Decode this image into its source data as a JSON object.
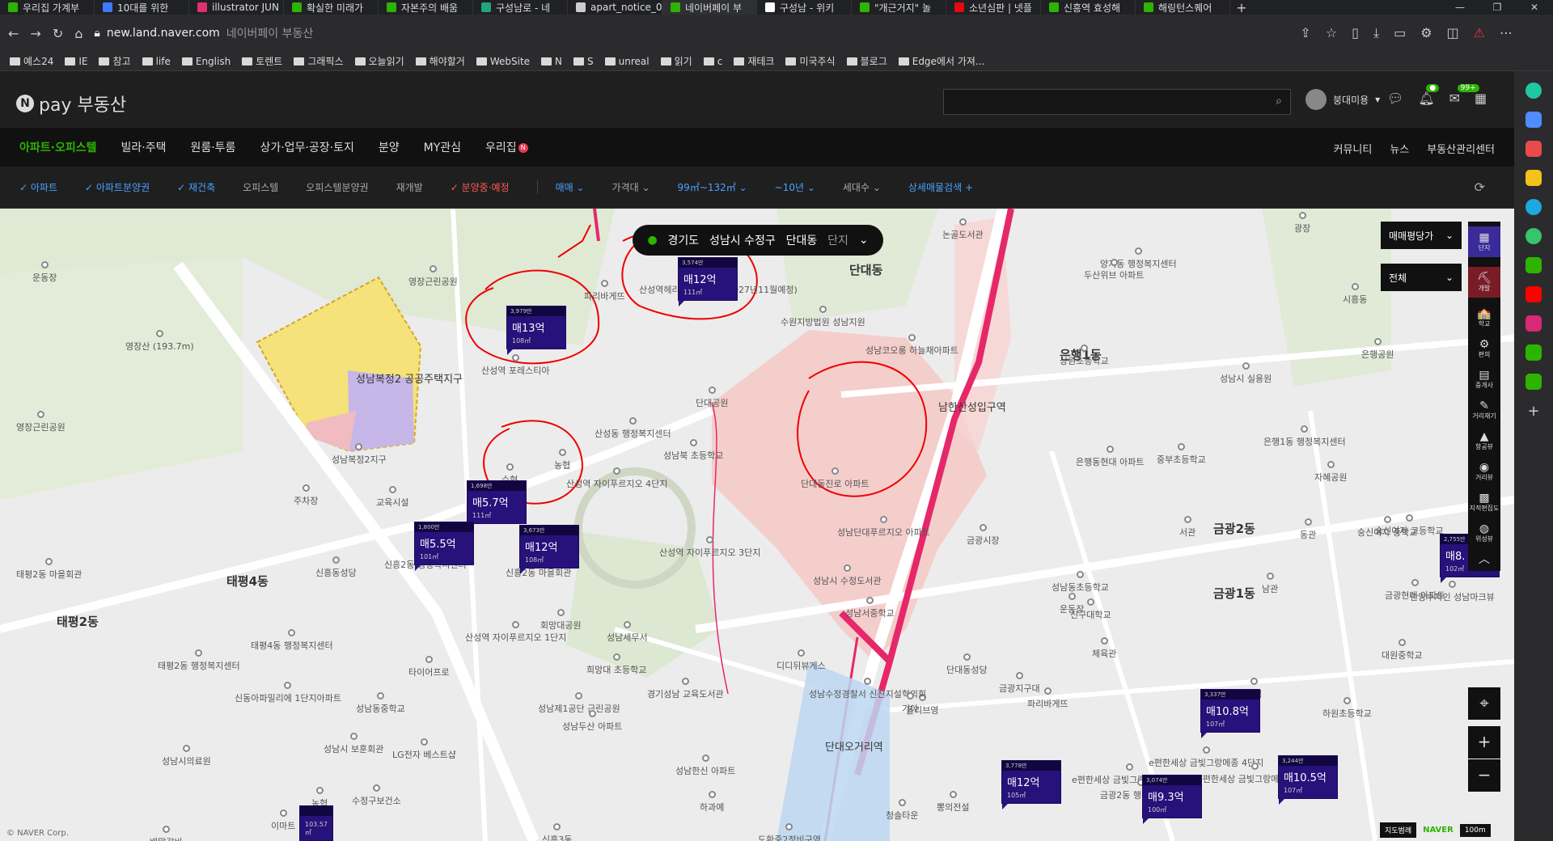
{
  "browser": {
    "tabs": [
      {
        "label": "우리집 가계부",
        "color": "#2db400"
      },
      {
        "label": "10대를 위한",
        "color": "#3b7bff"
      },
      {
        "label": "illustrator JUN",
        "color": "#e1306c"
      },
      {
        "label": "확실한 미래가",
        "color": "#2db400"
      },
      {
        "label": "자본주의 배움",
        "color": "#2db400"
      },
      {
        "label": "구성남로 - 네",
        "color": "#1fa67a"
      },
      {
        "label": "apart_notice_0",
        "color": "#cccccc"
      },
      {
        "label": "네이버페이 부",
        "color": "#2db400"
      },
      {
        "label": "구성남 - 위키",
        "color": "#ffffff"
      },
      {
        "label": "\"개근거지\" 놀",
        "color": "#2db400"
      },
      {
        "label": "소년심판 | 넷플",
        "color": "#e50914"
      },
      {
        "label": "신흥역 효성해",
        "color": "#2db400"
      },
      {
        "label": "해링턴스퀘어",
        "color": "#2db400"
      }
    ],
    "url": "new.land.naver.com",
    "page_title": "네이버페이 부동산",
    "bookmarks": [
      "예스24",
      "IE",
      "참고",
      "life",
      "English",
      "토렌트",
      "그래픽스",
      "오늘읽기",
      "해야할거",
      "WebSite",
      "N",
      "S",
      "unreal",
      "읽기",
      "c",
      "재테크",
      "미국주식",
      "블로그",
      "Edge에서 가져..."
    ]
  },
  "header": {
    "logo": "pay 부동산",
    "user": "붕대미용",
    "notif_badge": "99+"
  },
  "menu": {
    "items": [
      "아파트·오피스텔",
      "빌라·주택",
      "원룸·투룸",
      "상가·업무·공장·토지",
      "분양",
      "MY관심",
      "우리집"
    ],
    "right": [
      "커뮤니티",
      "뉴스",
      "부동산관리센터"
    ],
    "new_dot": "N"
  },
  "filters": {
    "items": [
      {
        "label": "✓ 아파트",
        "style": "on"
      },
      {
        "label": "✓ 아파트분양권",
        "style": "on"
      },
      {
        "label": "✓ 재건축",
        "style": "on"
      },
      {
        "label": "오피스텔",
        "style": ""
      },
      {
        "label": "오피스텔분양권",
        "style": ""
      },
      {
        "label": "재개발",
        "style": ""
      },
      {
        "label": "✓ 분양중·예정",
        "style": "red"
      },
      {
        "label": "매매 ⌄",
        "style": "dd sep"
      },
      {
        "label": "가격대 ⌄",
        "style": ""
      },
      {
        "label": "99㎡~132㎡ ⌄",
        "style": "dd"
      },
      {
        "label": "~10년 ⌄",
        "style": "dd"
      },
      {
        "label": "세대수 ⌄",
        "style": ""
      },
      {
        "label": "상세매물검색 +",
        "style": "dd"
      }
    ]
  },
  "location": {
    "province": "경기도",
    "city": "성남시 수정구",
    "dong": "단대동",
    "mode": "단지"
  },
  "map_controls": {
    "price_dropdown": "매매평당가",
    "all_dropdown": "전체",
    "tools": [
      {
        "icon": "▦",
        "label": "단지",
        "style": "blu"
      },
      {
        "icon": "⛏",
        "label": "개발",
        "style": "sel"
      },
      {
        "icon": "🏫",
        "label": "학교",
        "style": ""
      },
      {
        "icon": "⚙",
        "label": "편의",
        "style": ""
      },
      {
        "icon": "▤",
        "label": "중개사",
        "style": ""
      },
      {
        "icon": "✎",
        "label": "거리재기",
        "style": ""
      },
      {
        "icon": "▲",
        "label": "항공뷰",
        "style": ""
      },
      {
        "icon": "◉",
        "label": "거리뷰",
        "style": ""
      },
      {
        "icon": "▩",
        "label": "지적편집도",
        "style": ""
      },
      {
        "icon": "◍",
        "label": "위성뷰",
        "style": ""
      },
      {
        "icon": "︿",
        "label": "",
        "style": ""
      }
    ],
    "zoom_in": "+",
    "zoom_out": "−",
    "gps": "⌖",
    "map_legend": "지도범례",
    "naver": "NAVER",
    "scale": "100m"
  },
  "copyright": "© NAVER Corp.",
  "price_markers": [
    {
      "top": "3,979만",
      "price": "매13억",
      "area": "108㎡"
    },
    {
      "top": "3,574만",
      "price": "매12억",
      "area": "111㎡"
    },
    {
      "top": "1,698만",
      "price": "매5.7억",
      "area": "111㎡"
    },
    {
      "top": "1,800만",
      "price": "매5.5억",
      "area": "101㎡"
    },
    {
      "top": "3,673만",
      "price": "매12억",
      "area": "108㎡"
    },
    {
      "top": "2,755만",
      "price": "매8.",
      "area": "102㎡"
    },
    {
      "top": "3,337만",
      "price": "매10.8억",
      "area": "107㎡"
    },
    {
      "top": "3,778만",
      "price": "매12억",
      "area": "105㎡"
    },
    {
      "top": "3,074만",
      "price": "매9.3억",
      "area": "100㎡"
    },
    {
      "top": "3,244만",
      "price": "매10.5억",
      "area": "107㎡"
    },
    {
      "top": "",
      "price": "",
      "area": "103.57㎡"
    }
  ],
  "places": [
    {
      "text": "단대동",
      "cls": "big"
    },
    {
      "text": "성남복정2 공공주택지구",
      "cls": "mid"
    },
    {
      "text": "태평4동",
      "cls": "big"
    },
    {
      "text": "태평2동",
      "cls": "big"
    },
    {
      "text": "은행1동",
      "cls": "big"
    },
    {
      "text": "금광2동",
      "cls": "big"
    },
    {
      "text": "금광1동",
      "cls": "big"
    },
    {
      "text": "산성역헤리스톤아파트 (2027년11월예정)",
      "cls": ""
    },
    {
      "text": "영장근린공원",
      "cls": ""
    },
    {
      "text": "파리바게뜨",
      "cls": ""
    },
    {
      "text": "산성역 포레스티아",
      "cls": ""
    },
    {
      "text": "산성역 자이푸르지오 4단지",
      "cls": ""
    },
    {
      "text": "산성역 자이푸르지오 3단지",
      "cls": ""
    },
    {
      "text": "산성역 자이푸르지오 1단지",
      "cls": ""
    },
    {
      "text": "신흥2동 행정복지센터",
      "cls": ""
    },
    {
      "text": "남한산성입구역",
      "cls": "mid"
    },
    {
      "text": "단대오거리역",
      "cls": "mid"
    },
    {
      "text": "단대동진로 아파트",
      "cls": ""
    },
    {
      "text": "성남단대푸르지오 아파트",
      "cls": ""
    },
    {
      "text": "성남코오롱 하늘채아파트",
      "cls": ""
    },
    {
      "text": "수원지방법원 성남지원",
      "cls": ""
    },
    {
      "text": "단대공원",
      "cls": ""
    },
    {
      "text": "성남시 수정도서관",
      "cls": ""
    },
    {
      "text": "성남서중학교",
      "cls": ""
    },
    {
      "text": "디디뒤뷰게스",
      "cls": ""
    },
    {
      "text": "성남세무서",
      "cls": ""
    },
    {
      "text": "회망대공원",
      "cls": ""
    },
    {
      "text": "희망대 초등학교",
      "cls": ""
    },
    {
      "text": "경기성남 교육도서관",
      "cls": ""
    },
    {
      "text": "성남제1공단 근린공원",
      "cls": ""
    },
    {
      "text": "영장산 (193.7m)",
      "cls": ""
    },
    {
      "text": "운동장",
      "cls": ""
    },
    {
      "text": "신흥동성당",
      "cls": ""
    },
    {
      "text": "태평4동 행정복지센터",
      "cls": ""
    },
    {
      "text": "태평2동 행정복지센터",
      "cls": ""
    },
    {
      "text": "신동아파밀리에 1단지아파트",
      "cls": ""
    },
    {
      "text": "성남동중학교",
      "cls": ""
    },
    {
      "text": "성남시 보훈회관",
      "cls": ""
    },
    {
      "text": "LG전자 베스트샵",
      "cls": ""
    },
    {
      "text": "수정구보건소",
      "cls": ""
    },
    {
      "text": "성남시의료원",
      "cls": ""
    },
    {
      "text": "배말갈비",
      "cls": ""
    },
    {
      "text": "농협",
      "cls": ""
    },
    {
      "text": "신흥3동",
      "cls": ""
    },
    {
      "text": "하과예",
      "cls": ""
    },
    {
      "text": "청솔타운",
      "cls": ""
    },
    {
      "text": "뽕의전설",
      "cls": ""
    },
    {
      "text": "도환중2정비구역",
      "cls": ""
    },
    {
      "text": "e편한세상 금빛그랑메종 6단지",
      "cls": ""
    },
    {
      "text": "e편한세상 금빛그랑메종 4단지",
      "cls": ""
    },
    {
      "text": "e편한세상 금빛그랑메종 3단지",
      "cls": ""
    },
    {
      "text": "금광2동 행정복지센터",
      "cls": ""
    },
    {
      "text": "금광지구대",
      "cls": ""
    },
    {
      "text": "단대동성당",
      "cls": ""
    },
    {
      "text": "금광시장",
      "cls": ""
    },
    {
      "text": "성남동초등학교",
      "cls": ""
    },
    {
      "text": "신구대학교",
      "cls": ""
    },
    {
      "text": "운동장",
      "cls": ""
    },
    {
      "text": "체육관",
      "cls": ""
    },
    {
      "text": "하원초등학교",
      "cls": ""
    },
    {
      "text": "대원중학교",
      "cls": ""
    },
    {
      "text": "한양수자인 성남마크뷰",
      "cls": ""
    },
    {
      "text": "금광현대 아파트",
      "cls": ""
    },
    {
      "text": "숭신여자 고등학교",
      "cls": ""
    },
    {
      "text": "숭신여자 중학교",
      "cls": ""
    },
    {
      "text": "양지동 행정복지센터",
      "cls": ""
    },
    {
      "text": "상원초등학교",
      "cls": ""
    },
    {
      "text": "두산위브 아파트",
      "cls": ""
    },
    {
      "text": "논골도서관",
      "cls": ""
    },
    {
      "text": "은행공원",
      "cls": ""
    },
    {
      "text": "성남시 실용원",
      "cls": ""
    },
    {
      "text": "은행1동 행정복지센터",
      "cls": ""
    },
    {
      "text": "은행동현대 아파트",
      "cls": ""
    },
    {
      "text": "중부초등학교",
      "cls": ""
    },
    {
      "text": "자혜공원",
      "cls": ""
    },
    {
      "text": "성남두산 아파트",
      "cls": ""
    },
    {
      "text": "성남한신 아파트",
      "cls": ""
    },
    {
      "text": "파리바게뜨",
      "cls": ""
    },
    {
      "text": "올리브영",
      "cls": ""
    },
    {
      "text": "성남수정경찰서 신진지설혁의회",
      "cls": ""
    },
    {
      "text": "태평2동 마을회관",
      "cls": ""
    },
    {
      "text": "영장근린공원",
      "cls": ""
    },
    {
      "text": "성남복정2지구",
      "cls": ""
    },
    {
      "text": "수협",
      "cls": ""
    },
    {
      "text": "농협",
      "cls": ""
    },
    {
      "text": "주차장",
      "cls": ""
    },
    {
      "text": "교육시설",
      "cls": ""
    },
    {
      "text": "타이어프로",
      "cls": ""
    },
    {
      "text": "이마트",
      "cls": ""
    },
    {
      "text": "성남북 초등학교",
      "cls": ""
    },
    {
      "text": "산성동 행정복지센터",
      "cls": ""
    },
    {
      "text": "신흥2동 마을회관",
      "cls": ""
    },
    {
      "text": "광장",
      "cls": ""
    },
    {
      "text": "시흥동",
      "cls": ""
    },
    {
      "text": "서관",
      "cls": ""
    },
    {
      "text": "동관",
      "cls": ""
    },
    {
      "text": "남관",
      "cls": ""
    },
    {
      "text": "신협",
      "cls": ""
    },
    {
      "text": "기아",
      "cls": ""
    }
  ]
}
